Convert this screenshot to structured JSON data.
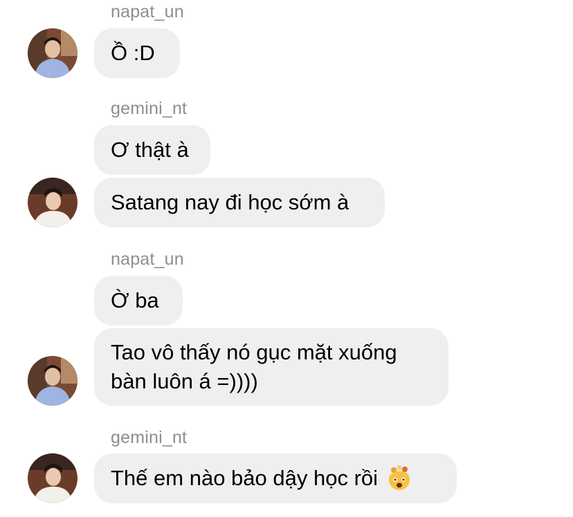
{
  "conversation": {
    "groups": [
      {
        "sender": "napat_un",
        "messages": [
          "Ồ :D"
        ]
      },
      {
        "sender": "gemini_nt",
        "messages": [
          "Ơ thật à",
          "Satang nay đi học sớm à"
        ]
      },
      {
        "sender": "napat_un",
        "messages": [
          "Ờ ba",
          "Tao vô thấy nó gục mặt xuống bàn luôn á =))))"
        ]
      },
      {
        "sender": "gemini_nt",
        "messages": [
          "Thế em nào bảo dậy học rồi"
        ],
        "emoji": "exploding-head-emoji"
      }
    ]
  },
  "avatars": {
    "napat_un": "avatar-napat-un",
    "gemini_nt": "avatar-gemini-nt"
  },
  "colors": {
    "bubble": "#efefef",
    "username": "#8e8e8e",
    "text": "#000000",
    "background": "#ffffff"
  }
}
